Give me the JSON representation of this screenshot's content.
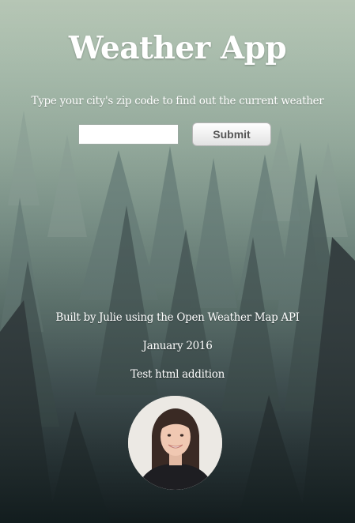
{
  "app": {
    "title": "Weather App",
    "subtitle": "Type your city's zip code to find out the current weather"
  },
  "form": {
    "zip_value": "",
    "zip_placeholder": "",
    "submit_label": "Submit"
  },
  "footer": {
    "credit": "Built by Julie using the Open Weather Map API",
    "date": "January 2016",
    "test_line": "Test html addition"
  },
  "images": {
    "background": "misty-forest-photo",
    "avatar": "profile-photo"
  },
  "colors": {
    "text": "#ffffff",
    "button_text": "#555555",
    "sky": "#b6c6b5",
    "forest_dark": "#161f22"
  }
}
